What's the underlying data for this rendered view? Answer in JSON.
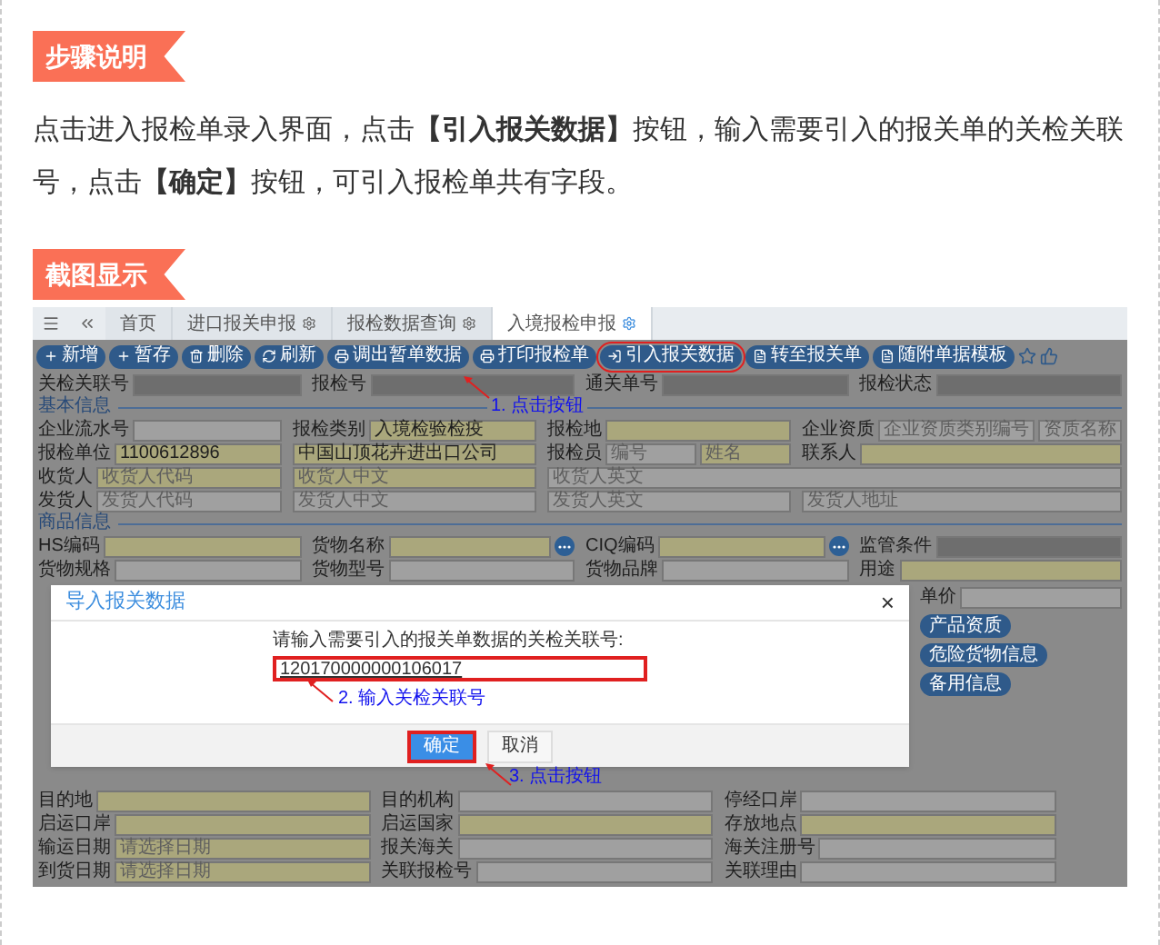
{
  "step_tag": {
    "label": "步骤说明"
  },
  "description": "点击进入报检单录入界面，点击**【引入报关数据】**按钮，输入需要引入的报关单的关检关联号，点击**【确定】**按钮，可引入报检单共有字段。",
  "screenshot_tag": {
    "label": "截图显示"
  },
  "app": {
    "tabs": [
      {
        "label": "首页",
        "selected": false,
        "closable": false
      },
      {
        "label": "进口报关申报",
        "selected": false,
        "closable": true
      },
      {
        "label": "报检数据查询",
        "selected": false,
        "closable": true
      },
      {
        "label": "入境报检申报",
        "selected": true,
        "closable": true
      }
    ],
    "toolbar": [
      {
        "label": "新增",
        "highlighted": false
      },
      {
        "label": "暂存",
        "highlighted": false
      },
      {
        "label": "删除",
        "highlighted": false
      },
      {
        "label": "刷新",
        "highlighted": false
      },
      {
        "label": "调出暂单数据",
        "highlighted": false
      },
      {
        "label": "打印报检单",
        "highlighted": false
      },
      {
        "label": "引入报关数据",
        "highlighted": true
      },
      {
        "label": "转至报关单",
        "highlighted": false
      },
      {
        "label": "随附单据模板",
        "highlighted": false
      }
    ],
    "top_rows": [
      [
        {
          "label": "关检关联号",
          "inputs": [
            {
              "kind": "grey"
            }
          ]
        },
        {
          "label": "报检号",
          "inputs": [
            {
              "kind": "grey"
            }
          ]
        },
        {
          "label": "通关单号",
          "inputs": [
            {
              "kind": "grey"
            }
          ]
        },
        {
          "label": "报检状态",
          "inputs": [
            {
              "kind": "grey"
            }
          ]
        }
      ]
    ],
    "sections": [
      {
        "title": "基本信息",
        "note": "1. 点击按钮",
        "rows": [
          [
            {
              "label": "企业流水号",
              "inputs": [
                {
                  "kind": "white"
                }
              ]
            },
            {
              "label": "报检类别",
              "inputs": [
                {
                  "kind": "yellow",
                  "value": "入境检验检疫"
                }
              ]
            },
            {
              "label": "报检地",
              "inputs": [
                {
                  "kind": "yellow"
                }
              ]
            },
            {
              "label": "企业资质",
              "inputs": [
                {
                  "kind": "white",
                  "placeholder": "企业资质类别编号"
                },
                {
                  "kind": "white",
                  "placeholder": "资质名称"
                }
              ]
            }
          ],
          [
            {
              "label": "报检单位",
              "inputs": [
                {
                  "kind": "yellow",
                  "value": "1100612896"
                }
              ]
            },
            {
              "inputs": [
                {
                  "kind": "yellow",
                  "value": "中国山顶花卉进出口公司"
                }
              ]
            },
            {
              "label": "报检员",
              "inputs": [
                {
                  "kind": "white",
                  "placeholder": "编号"
                },
                {
                  "kind": "yellow",
                  "placeholder": "姓名"
                }
              ]
            },
            {
              "label": "联系人",
              "inputs": [
                {
                  "kind": "yellow"
                }
              ]
            }
          ],
          [
            {
              "label": "收货人",
              "inputs": [
                {
                  "kind": "yellow",
                  "placeholder": "收货人代码"
                }
              ]
            },
            {
              "inputs": [
                {
                  "kind": "yellow",
                  "placeholder": "收货人中文"
                }
              ]
            },
            {
              "inputs": [
                {
                  "kind": "white",
                  "placeholder": "收货人英文"
                }
              ]
            }
          ],
          [
            {
              "label": "发货人",
              "inputs": [
                {
                  "kind": "white",
                  "placeholder": "发货人代码"
                }
              ]
            },
            {
              "inputs": [
                {
                  "kind": "white",
                  "placeholder": "发货人中文"
                }
              ]
            },
            {
              "inputs": [
                {
                  "kind": "white",
                  "placeholder": "发货人英文"
                }
              ]
            },
            {
              "inputs": [
                {
                  "kind": "white",
                  "placeholder": "发货人地址"
                }
              ]
            }
          ]
        ]
      },
      {
        "title": "商品信息",
        "rows": [
          [
            {
              "label": "HS编码",
              "inputs": [
                {
                  "kind": "yellow"
                }
              ]
            },
            {
              "label": "货物名称",
              "lookup": true,
              "inputs": [
                {
                  "kind": "yellow"
                }
              ]
            },
            {
              "label": "CIQ编码",
              "lookup": true,
              "inputs": [
                {
                  "kind": "yellow"
                }
              ]
            },
            {
              "label": "监管条件",
              "inputs": [
                {
                  "kind": "grey"
                }
              ]
            }
          ],
          [
            {
              "label": "货物规格",
              "inputs": [
                {
                  "kind": "white"
                }
              ]
            },
            {
              "label": "货物型号",
              "inputs": [
                {
                  "kind": "white"
                }
              ]
            },
            {
              "label": "货物品牌",
              "inputs": [
                {
                  "kind": "white"
                }
              ]
            },
            {
              "label": "用途",
              "inputs": [
                {
                  "kind": "yellow"
                }
              ]
            }
          ]
        ]
      }
    ],
    "dialog": {
      "title": "导入报关数据",
      "close": "×",
      "prompt": "请输入需要引入的报关单数据的关检关联号:",
      "input": {
        "value": "120170000000106017",
        "highlighted": true
      },
      "note": "2. 输入关检关联号",
      "buttons": [
        {
          "label": "确定",
          "kind": "primary",
          "highlighted": true
        },
        {
          "label": "取消",
          "kind": "default",
          "highlighted": false
        }
      ],
      "footer_note": "3. 点击按钮"
    },
    "side": {
      "field": {
        "label": "单价",
        "inputs": [
          {
            "kind": "white"
          }
        ]
      },
      "buttons": [
        "产品资质",
        "危险货物信息",
        "备用信息"
      ]
    },
    "bottom_rows": [
      [
        {
          "label": "目的地",
          "inputs": [
            {
              "kind": "yellow"
            }
          ]
        },
        {
          "label": "目的机构",
          "inputs": [
            {
              "kind": "white"
            }
          ]
        },
        {
          "label": "停经口岸",
          "inputs": [
            {
              "kind": "white"
            }
          ]
        }
      ],
      [
        {
          "label": "启运口岸",
          "inputs": [
            {
              "kind": "yellow"
            }
          ]
        },
        {
          "label": "启运国家",
          "inputs": [
            {
              "kind": "yellow"
            }
          ]
        },
        {
          "label": "存放地点",
          "inputs": [
            {
              "kind": "yellow"
            }
          ]
        }
      ],
      [
        {
          "label": "输运日期",
          "inputs": [
            {
              "kind": "yellow",
              "placeholder": "请选择日期"
            }
          ]
        },
        {
          "label": "报关海关",
          "inputs": [
            {
              "kind": "white"
            }
          ]
        },
        {
          "label": "海关注册号",
          "inputs": [
            {
              "kind": "white"
            }
          ]
        }
      ],
      [
        {
          "label": "到货日期",
          "inputs": [
            {
              "kind": "yellow",
              "placeholder": "请选择日期"
            }
          ]
        },
        {
          "label": "关联报检号",
          "inputs": [
            {
              "kind": "white"
            }
          ]
        },
        {
          "label": "关联理由",
          "inputs": [
            {
              "kind": "white"
            }
          ]
        }
      ]
    ]
  }
}
